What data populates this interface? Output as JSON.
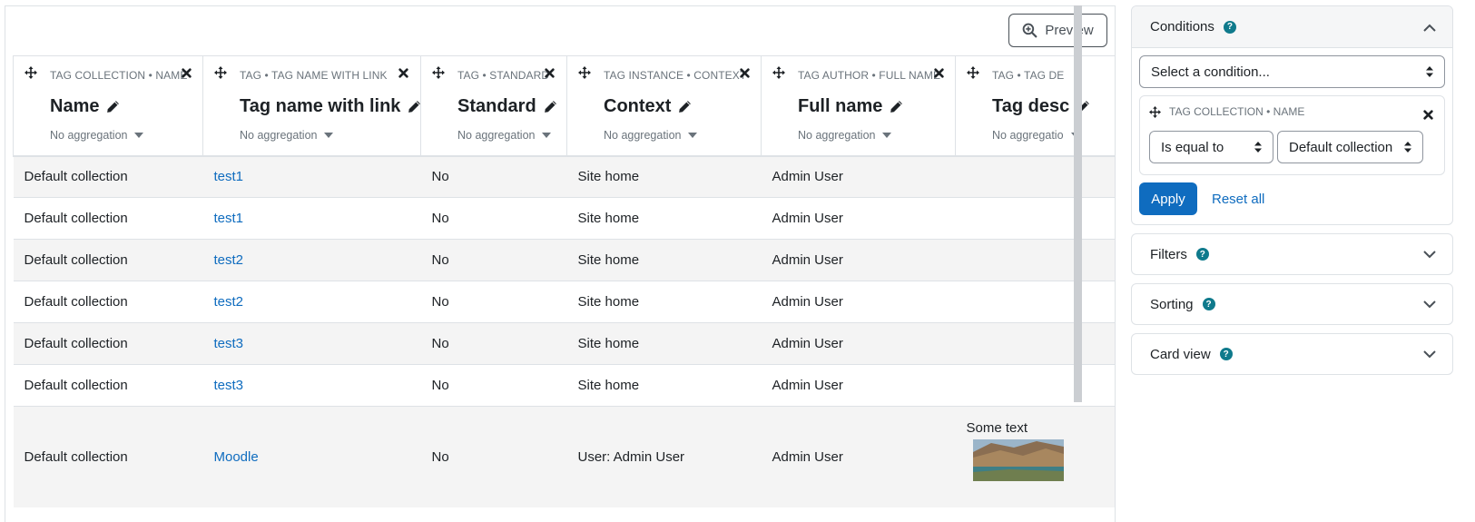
{
  "toolbar": {
    "preview_label": "Preview"
  },
  "columns": [
    {
      "caption": "TAG COLLECTION • NAME",
      "title": "Name",
      "aggregation": "No aggregation"
    },
    {
      "caption": "TAG • TAG NAME WITH LINK",
      "title": "Tag name with link",
      "aggregation": "No aggregation"
    },
    {
      "caption": "TAG • STANDARD",
      "title": "Standard",
      "aggregation": "No aggregation"
    },
    {
      "caption": "TAG INSTANCE • CONTEXT",
      "title": "Context",
      "aggregation": "No aggregation"
    },
    {
      "caption": "TAG AUTHOR • FULL NAME",
      "title": "Full name",
      "aggregation": "No aggregation"
    },
    {
      "caption": "TAG • TAG DE",
      "title": "Tag desc",
      "aggregation": "No aggregatio"
    }
  ],
  "rows": [
    {
      "name": "Default collection",
      "tag": "test1",
      "standard": "No",
      "context": "Site home",
      "author": "Admin User"
    },
    {
      "name": "Default collection",
      "tag": "test1",
      "standard": "No",
      "context": "Site home",
      "author": "Admin User"
    },
    {
      "name": "Default collection",
      "tag": "test2",
      "standard": "No",
      "context": "Site home",
      "author": "Admin User"
    },
    {
      "name": "Default collection",
      "tag": "test2",
      "standard": "No",
      "context": "Site home",
      "author": "Admin User"
    },
    {
      "name": "Default collection",
      "tag": "test3",
      "standard": "No",
      "context": "Site home",
      "author": "Admin User"
    },
    {
      "name": "Default collection",
      "tag": "test3",
      "standard": "No",
      "context": "Site home",
      "author": "Admin User"
    },
    {
      "name": "Default collection",
      "tag": "Moodle",
      "standard": "No",
      "context": "User: Admin User",
      "author": "Admin User",
      "description": "Some text"
    }
  ],
  "sidebar": {
    "conditions": {
      "title": "Conditions",
      "select_placeholder": "Select a condition...",
      "condition": {
        "caption": "TAG COLLECTION • NAME",
        "operator": "Is equal to",
        "value": "Default collection"
      },
      "apply_label": "Apply",
      "reset_label": "Reset all"
    },
    "filters_title": "Filters",
    "sorting_title": "Sorting",
    "cardview_title": "Card view"
  },
  "colors": {
    "accent": "#0f6cbf",
    "help": "#0f7a8c"
  }
}
